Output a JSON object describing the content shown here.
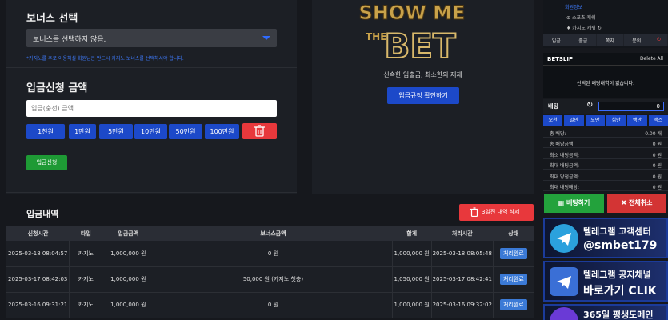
{
  "bonus": {
    "title": "보너스 선택",
    "selected": "보너스를 선택하지 않음.",
    "note": "*카지노를 주로 이용하실 회원님은 반드시 카지노 보너스를 선택하셔야 합니다."
  },
  "deposit": {
    "title": "입금신청 금액",
    "placeholder": "입금(충전) 금액",
    "amounts": [
      "1천원",
      "1만원",
      "5만원",
      "10만원",
      "50만원",
      "100만원"
    ],
    "submit": "입금신청"
  },
  "promo": {
    "text": "신속한 입출금, 최소한의 제재",
    "button": "입금규정 확인하기"
  },
  "history": {
    "title": "입금내역",
    "delete_button": "3일전 내역 삭제",
    "columns": [
      "신청시간",
      "타입",
      "입금금액",
      "보너스금액",
      "합계",
      "처리시간",
      "상태"
    ],
    "rows": [
      [
        "2025-03-18 08:04:57",
        "카지노",
        "1,000,000 원",
        "0 원",
        "1,000,000 원",
        "2025-03-18 08:05:48",
        "처리완료"
      ],
      [
        "2025-03-17 08:42:03",
        "카지노",
        "1,000,000 원",
        "50,000 원 (카지노 첫충)",
        "1,050,000 원",
        "2025-03-17 08:42:41",
        "처리완료"
      ],
      [
        "2025-03-16 09:31:21",
        "카지노",
        "1,000,000 원",
        "0 원",
        "1,000,000 원",
        "2025-03-16 09:32:02",
        "처리완료"
      ]
    ]
  },
  "sidebar": {
    "top_label": "회원정보",
    "sports_cash": "스포츠 캐쉬",
    "casino_cash": "카지노 캐쉬",
    "nav": [
      "입금",
      "출금",
      "쪽지",
      "문의"
    ],
    "betslip_title": "BETSLIP",
    "delete_all": "Delete All",
    "empty_msg": "선택된 배팅내역이 없습니다.",
    "stake_label": "배팅",
    "stake_value": "0",
    "quick": [
      "오천",
      "일만",
      "오만",
      "십만",
      "백만",
      "맥스"
    ],
    "info": [
      {
        "k": "총 배당:",
        "v": "0.00 배"
      },
      {
        "k": "총 배당금액:",
        "v": "0 원"
      },
      {
        "k": "최소 배팅금액:",
        "v": "0 원"
      },
      {
        "k": "최대 배팅금액:",
        "v": "0 원"
      },
      {
        "k": "최대 당첨금액:",
        "v": "0 원"
      },
      {
        "k": "최대 배팅배당:",
        "v": "0 원"
      }
    ],
    "bet_button": "배팅하기",
    "cancel_button": "전체취소",
    "banner1": {
      "l1": "텔레그램 고객센터",
      "l2": "@smbet179"
    },
    "banner2": {
      "l1": "텔레그램 공지채널",
      "l2": "바로가기 CLIK"
    },
    "banner3": {
      "l1": "365일 평생도메인"
    }
  },
  "colors": {
    "accent": "#1c49c9",
    "danger": "#e8383c",
    "success": "#1e9a35"
  }
}
